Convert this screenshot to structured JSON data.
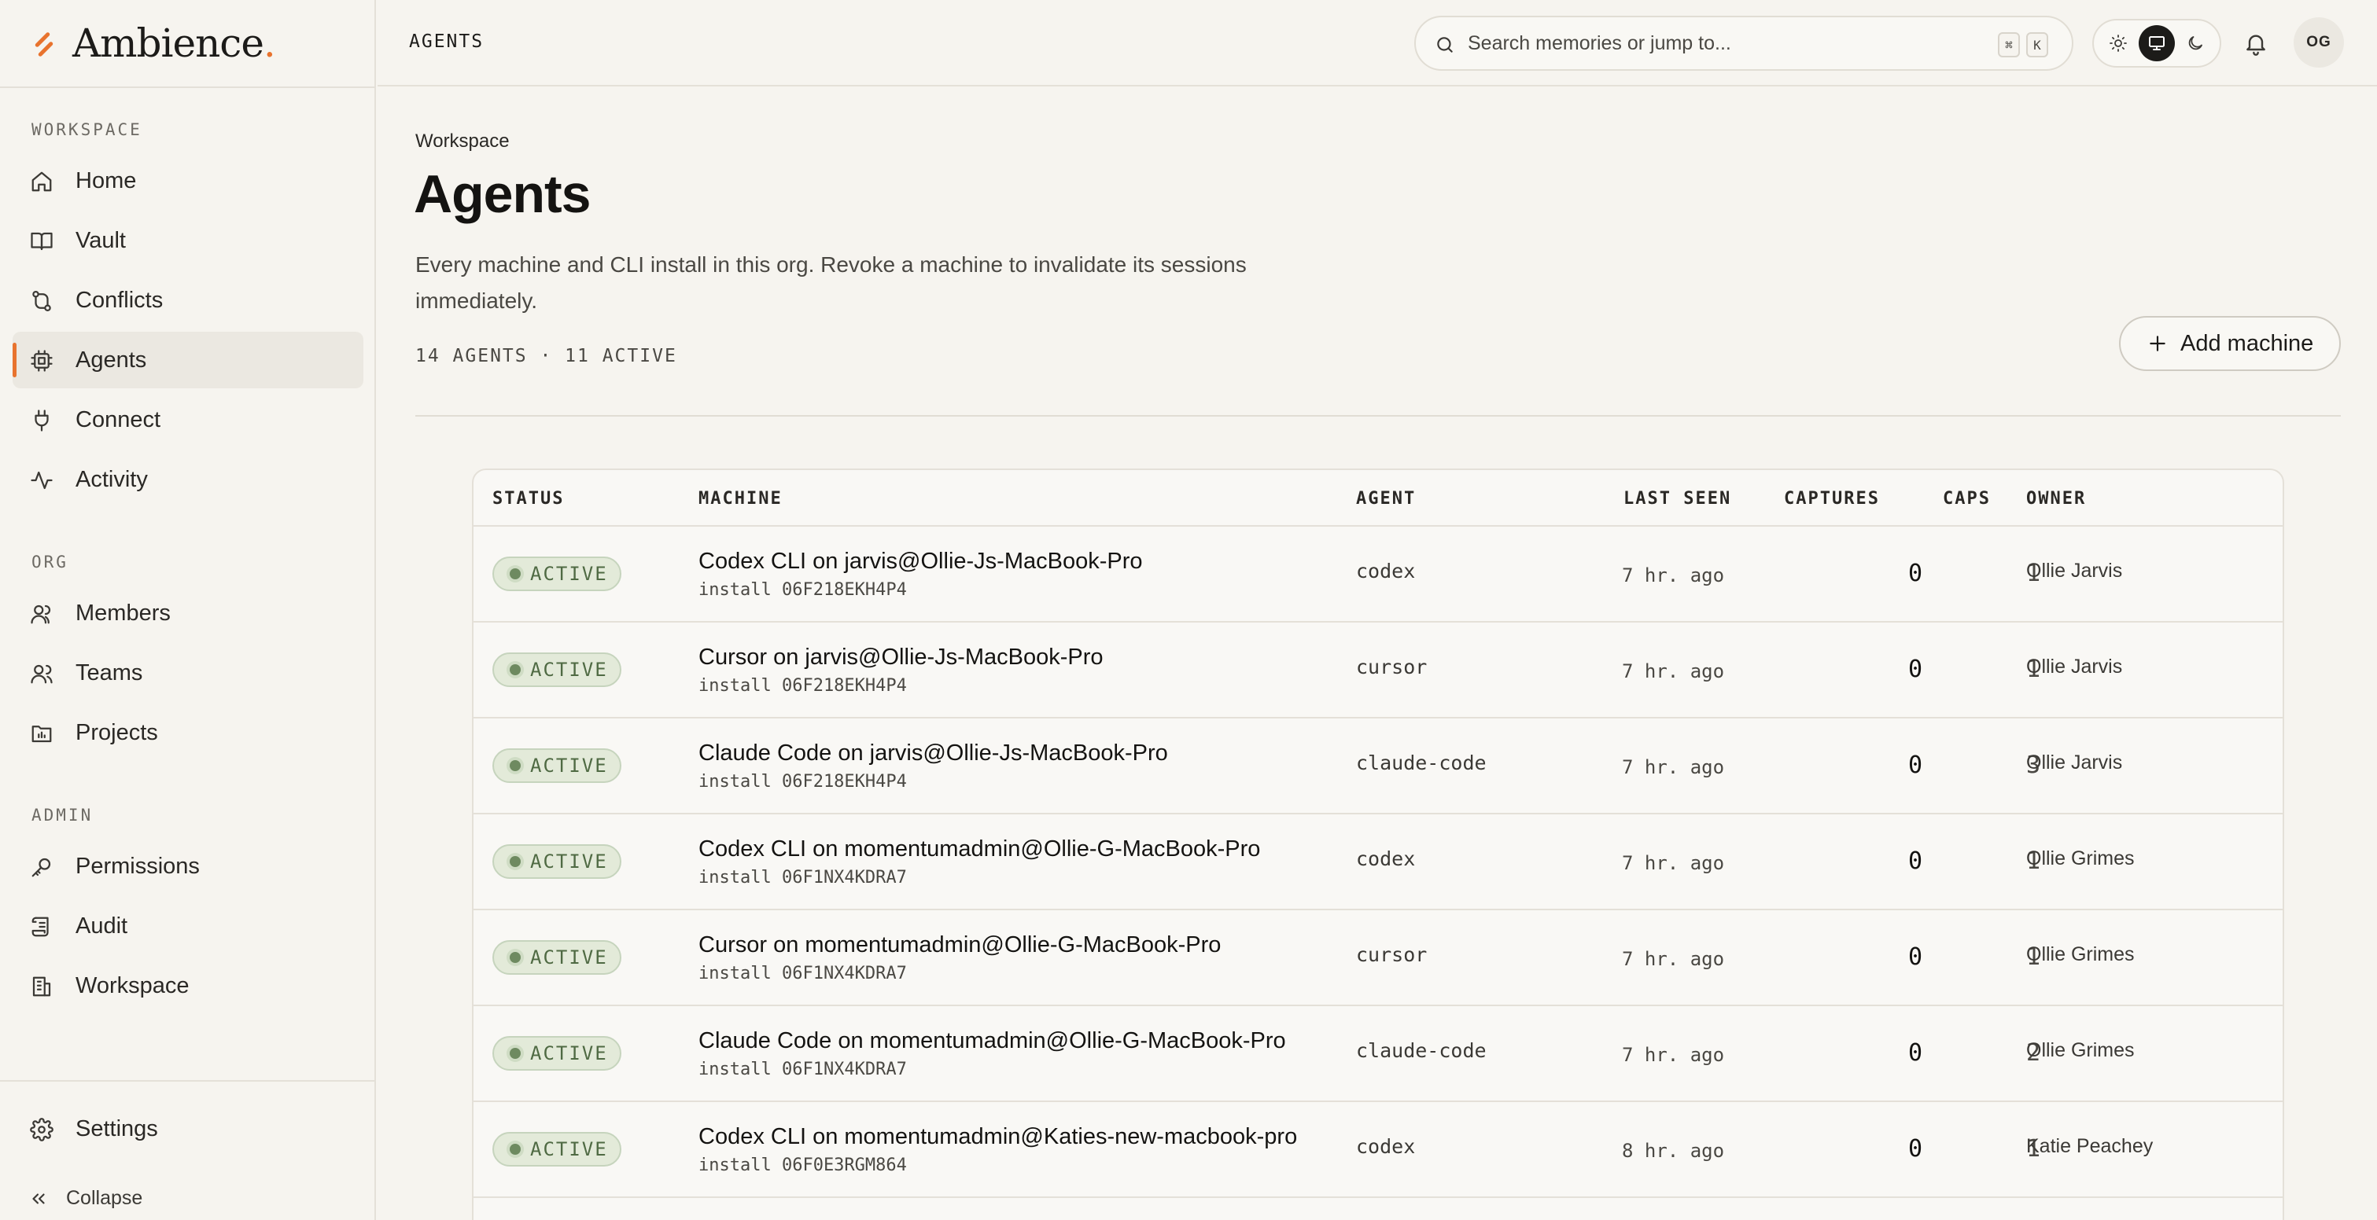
{
  "brand": {
    "name": "Ambience",
    "dot": "."
  },
  "topbar": {
    "breadcrumb": "AGENTS",
    "search_placeholder": "Search memories or jump to...",
    "kbd_cmd": "⌘",
    "kbd_key": "K",
    "avatar_initials": "OG"
  },
  "sidebar": {
    "workspace_label": "WORKSPACE",
    "org_label": "ORG",
    "admin_label": "ADMIN",
    "workspace_items": [
      {
        "label": "Home",
        "icon": "home-icon"
      },
      {
        "label": "Vault",
        "icon": "book-icon"
      },
      {
        "label": "Conflicts",
        "icon": "git-compare-icon"
      },
      {
        "label": "Agents",
        "icon": "chip-icon",
        "active": true
      },
      {
        "label": "Connect",
        "icon": "plug-icon"
      },
      {
        "label": "Activity",
        "icon": "activity-icon"
      }
    ],
    "org_items": [
      {
        "label": "Members",
        "icon": "users-icon"
      },
      {
        "label": "Teams",
        "icon": "team-icon"
      },
      {
        "label": "Projects",
        "icon": "folder-chart-icon"
      }
    ],
    "admin_items": [
      {
        "label": "Permissions",
        "icon": "key-icon"
      },
      {
        "label": "Audit",
        "icon": "scroll-icon"
      },
      {
        "label": "Workspace",
        "icon": "building-icon"
      }
    ],
    "settings_label": "Settings",
    "collapse_label": "Collapse"
  },
  "page": {
    "overline": "Workspace",
    "title": "Agents",
    "description": "Every machine and CLI install in this org. Revoke a machine to invalidate its sessions immediately.",
    "stats": "14 AGENTS · 11 ACTIVE",
    "add_button": "Add machine"
  },
  "table": {
    "headers": {
      "status": "STATUS",
      "machine": "MACHINE",
      "agent": "AGENT",
      "last_seen": "LAST SEEN",
      "captures": "CAPTURES",
      "caps": "CAPS",
      "owner": "OWNER"
    },
    "rows": [
      {
        "status": "ACTIVE",
        "machine": "Codex CLI on jarvis@Ollie-Js-MacBook-Pro",
        "install": "install 06F218EKH4P4",
        "agent": "codex",
        "last_seen": "7 hr. ago",
        "captures": "0",
        "caps": "1",
        "owner": "Ollie Jarvis"
      },
      {
        "status": "ACTIVE",
        "machine": "Cursor on jarvis@Ollie-Js-MacBook-Pro",
        "install": "install 06F218EKH4P4",
        "agent": "cursor",
        "last_seen": "7 hr. ago",
        "captures": "0",
        "caps": "1",
        "owner": "Ollie Jarvis"
      },
      {
        "status": "ACTIVE",
        "machine": "Claude Code on jarvis@Ollie-Js-MacBook-Pro",
        "install": "install 06F218EKH4P4",
        "agent": "claude-code",
        "last_seen": "7 hr. ago",
        "captures": "0",
        "caps": "3",
        "owner": "Ollie Jarvis"
      },
      {
        "status": "ACTIVE",
        "machine": "Codex CLI on momentumadmin@Ollie-G-MacBook-Pro",
        "install": "install 06F1NX4KDRA7",
        "agent": "codex",
        "last_seen": "7 hr. ago",
        "captures": "0",
        "caps": "1",
        "owner": "Ollie Grimes"
      },
      {
        "status": "ACTIVE",
        "machine": "Cursor on momentumadmin@Ollie-G-MacBook-Pro",
        "install": "install 06F1NX4KDRA7",
        "agent": "cursor",
        "last_seen": "7 hr. ago",
        "captures": "0",
        "caps": "1",
        "owner": "Ollie Grimes"
      },
      {
        "status": "ACTIVE",
        "machine": "Claude Code on momentumadmin@Ollie-G-MacBook-Pro",
        "install": "install 06F1NX4KDRA7",
        "agent": "claude-code",
        "last_seen": "7 hr. ago",
        "captures": "0",
        "caps": "2",
        "owner": "Ollie Grimes"
      },
      {
        "status": "ACTIVE",
        "machine": "Codex CLI on momentumadmin@Katies-new-macbook-pro",
        "install": "install 06F0E3RGM864",
        "agent": "codex",
        "last_seen": "8 hr. ago",
        "captures": "0",
        "caps": "1",
        "owner": "Katie Peachey"
      }
    ]
  },
  "colors": {
    "accent": "#e8732e",
    "active_badge_bg": "#e3ead9",
    "active_badge_text": "#4f6a43",
    "background": "#f6f4ef"
  }
}
